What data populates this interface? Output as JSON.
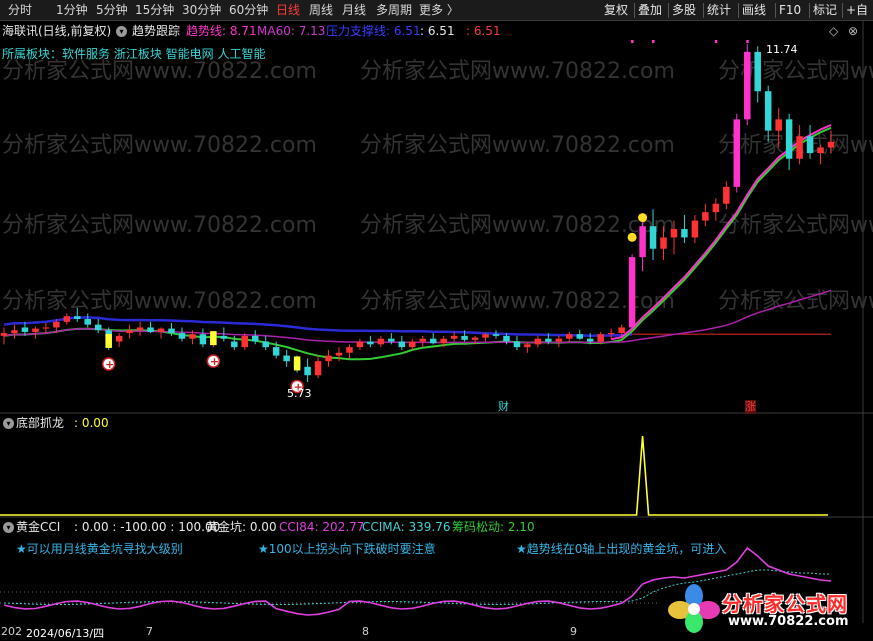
{
  "toolbar": {
    "left_items": [
      "分时",
      "1分钟",
      "5分钟",
      "15分钟",
      "30分钟",
      "60分钟",
      "日线",
      "周线",
      "月线",
      "多周期",
      "更多 〉"
    ],
    "active": "日线",
    "right_items": [
      "复权",
      "叠加",
      "多股",
      "统计",
      "画线",
      "F10",
      "标记",
      "+自"
    ]
  },
  "main": {
    "stock": "海联讯(日线,前复权)",
    "indicator_name": "趋势跟踪",
    "trend_label": "趋势线: 8.71",
    "ma60_label": "MA60: 7.13",
    "pressure_label": "压力支撑线: 6.51",
    "val1": ": 6.51",
    "val2": ": 6.51",
    "sector": "所属板块：软件服务 浙江板块 智能电网 人工智能",
    "high_label": "11.74",
    "low_label": "5.73",
    "marker_cai": "财",
    "marker_zhang": "涨"
  },
  "panel2": {
    "name": "底部抓龙",
    "value": ": 0.00"
  },
  "panel3": {
    "name": "黄金CCI",
    "values": ": 0.00 : -100.00 : 100.00",
    "gold_pit": "黄金坑: 0.00",
    "cci84": "CCI84: 202.77",
    "ccima": "CCIMA: 339.76",
    "chip": "筹码松动: 2.10",
    "hint1": "★可以用月线黄金坑寻找大级别",
    "hint2": "★100以上拐头向下跌破时要注意",
    "hint3": "★趋势线在0轴上出现的黄金坑，可进入"
  },
  "dates": {
    "first": "2024/06/13/四",
    "prefix": "202",
    "m7": "7",
    "m8": "8",
    "m9": "9"
  },
  "logo": {
    "name": "分析家公式网",
    "url": "www.70822.com"
  },
  "watermark": "分析家公式网www.70822.com",
  "chart_data": {
    "type": "candlestick",
    "period": "daily",
    "high_label": 11.74,
    "low_label": 5.73,
    "candles": [
      [
        6.55,
        6.7,
        6.4,
        6.6
      ],
      [
        6.6,
        6.75,
        6.5,
        6.65
      ],
      [
        6.7,
        6.8,
        6.55,
        6.62
      ],
      [
        6.62,
        6.72,
        6.5,
        6.68
      ],
      [
        6.68,
        6.78,
        6.6,
        6.7
      ],
      [
        6.7,
        6.85,
        6.6,
        6.8
      ],
      [
        6.8,
        6.95,
        6.75,
        6.9
      ],
      [
        6.9,
        7.05,
        6.8,
        6.85
      ],
      [
        6.85,
        6.95,
        6.7,
        6.75
      ],
      [
        6.75,
        6.85,
        6.6,
        6.65
      ],
      [
        6.65,
        6.7,
        6.3,
        6.45
      ],
      [
        6.45,
        6.6,
        6.35,
        6.55
      ],
      [
        6.6,
        6.75,
        6.5,
        6.65
      ],
      [
        6.65,
        6.8,
        6.55,
        6.7
      ],
      [
        6.7,
        6.8,
        6.6,
        6.62
      ],
      [
        6.62,
        6.7,
        6.5,
        6.68
      ],
      [
        6.68,
        6.78,
        6.55,
        6.6
      ],
      [
        6.6,
        6.7,
        6.45,
        6.5
      ],
      [
        6.5,
        6.65,
        6.4,
        6.58
      ],
      [
        6.58,
        6.68,
        6.35,
        6.4
      ],
      [
        6.4,
        6.6,
        6.35,
        6.55
      ],
      [
        6.55,
        6.7,
        6.45,
        6.5
      ],
      [
        6.45,
        6.55,
        6.3,
        6.35
      ],
      [
        6.35,
        6.6,
        6.3,
        6.55
      ],
      [
        6.55,
        6.65,
        6.4,
        6.45
      ],
      [
        6.45,
        6.55,
        6.3,
        6.35
      ],
      [
        6.35,
        6.45,
        6.15,
        6.2
      ],
      [
        6.2,
        6.3,
        6.0,
        6.1
      ],
      [
        6.1,
        6.2,
        5.9,
        6.0
      ],
      [
        6.0,
        6.15,
        5.73,
        5.85
      ],
      [
        5.85,
        6.2,
        5.8,
        6.1
      ],
      [
        6.1,
        6.3,
        6.0,
        6.2
      ],
      [
        6.2,
        6.35,
        6.1,
        6.25
      ],
      [
        6.25,
        6.4,
        6.15,
        6.35
      ],
      [
        6.35,
        6.5,
        6.3,
        6.45
      ],
      [
        6.45,
        6.55,
        6.35,
        6.4
      ],
      [
        6.4,
        6.55,
        6.35,
        6.5
      ],
      [
        6.5,
        6.6,
        6.4,
        6.45
      ],
      [
        6.45,
        6.55,
        6.3,
        6.35
      ],
      [
        6.35,
        6.5,
        6.3,
        6.45
      ],
      [
        6.45,
        6.55,
        6.35,
        6.5
      ],
      [
        6.5,
        6.6,
        6.4,
        6.42
      ],
      [
        6.42,
        6.55,
        6.35,
        6.5
      ],
      [
        6.5,
        6.62,
        6.45,
        6.55
      ],
      [
        6.55,
        6.65,
        6.45,
        6.48
      ],
      [
        6.48,
        6.55,
        6.4,
        6.52
      ],
      [
        6.52,
        6.6,
        6.45,
        6.58
      ],
      [
        6.58,
        6.65,
        6.5,
        6.55
      ],
      [
        6.55,
        6.6,
        6.4,
        6.45
      ],
      [
        6.45,
        6.55,
        6.3,
        6.35
      ],
      [
        6.35,
        6.45,
        6.25,
        6.4
      ],
      [
        6.4,
        6.55,
        6.35,
        6.5
      ],
      [
        6.5,
        6.6,
        6.4,
        6.45
      ],
      [
        6.45,
        6.55,
        6.35,
        6.5
      ],
      [
        6.5,
        6.62,
        6.45,
        6.58
      ],
      [
        6.58,
        6.66,
        6.48,
        6.5
      ],
      [
        6.5,
        6.6,
        6.4,
        6.45
      ],
      [
        6.45,
        6.62,
        6.4,
        6.58
      ],
      [
        6.58,
        6.68,
        6.5,
        6.6
      ],
      [
        6.6,
        6.75,
        6.55,
        6.7
      ],
      [
        6.7,
        8.0,
        6.65,
        7.95
      ],
      [
        7.95,
        8.7,
        7.7,
        8.5
      ],
      [
        8.5,
        8.8,
        7.9,
        8.1
      ],
      [
        8.1,
        8.5,
        7.9,
        8.3
      ],
      [
        8.3,
        8.6,
        8.0,
        8.45
      ],
      [
        8.45,
        8.7,
        8.2,
        8.3
      ],
      [
        8.3,
        8.7,
        8.2,
        8.6
      ],
      [
        8.6,
        8.9,
        8.5,
        8.75
      ],
      [
        8.75,
        9.0,
        8.6,
        8.9
      ],
      [
        8.9,
        9.3,
        8.8,
        9.2
      ],
      [
        9.2,
        10.5,
        9.1,
        10.4
      ],
      [
        10.4,
        11.74,
        10.3,
        11.6
      ],
      [
        11.6,
        11.7,
        10.7,
        10.9
      ],
      [
        10.9,
        11.0,
        10.0,
        10.2
      ],
      [
        10.2,
        10.6,
        9.9,
        10.4
      ],
      [
        10.4,
        10.5,
        9.5,
        9.7
      ],
      [
        9.7,
        10.3,
        9.6,
        10.1
      ],
      [
        10.1,
        10.3,
        9.7,
        9.8
      ],
      [
        9.8,
        9.95,
        9.6,
        9.9
      ],
      [
        9.9,
        10.2,
        9.8,
        10.0
      ]
    ],
    "series": [
      {
        "name": "趋势线",
        "color": "#ff33cc"
      },
      {
        "name": "MA60",
        "color": "#d633d6"
      },
      {
        "name": "压力支撑线",
        "color": "#3b3bff"
      }
    ],
    "panel2_series": {
      "name": "底部抓龙",
      "spike_index": 61,
      "spike_value": 1,
      "baseline": 0
    },
    "panel3_series": [
      {
        "name": "CCI84",
        "color": "#e040e0"
      },
      {
        "name": "CCIMA",
        "color": "#3fd1d1"
      }
    ]
  }
}
